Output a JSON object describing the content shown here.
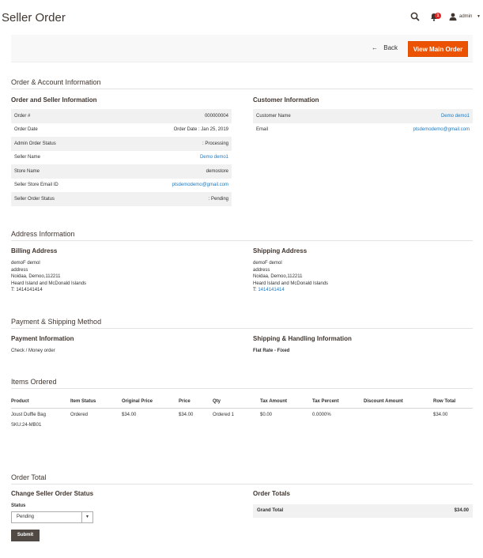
{
  "header": {
    "title": "Seller Order",
    "notification_count": "1",
    "admin_label": "admin"
  },
  "actions": {
    "back_label": "Back",
    "view_main_order_label": "View Main Order"
  },
  "order_account": {
    "section_title": "Order & Account Information",
    "order_seller_title": "Order and Seller Information",
    "rows": [
      {
        "label": "Order #",
        "value": "000000004"
      },
      {
        "label": "Order Date",
        "value": "Order Date : Jan 25, 2019"
      },
      {
        "label": "Admin Order Status",
        "value": ": Processing"
      },
      {
        "label": "Seller Name",
        "value": "Demo demo1"
      },
      {
        "label": "Store Name",
        "value": "demostore"
      },
      {
        "label": "Seller Store Email ID",
        "value": "ptsdemodemo@gmail.com"
      },
      {
        "label": "Seller Order Status",
        "value": ": Pending"
      }
    ],
    "customer_title": "Customer Information",
    "customer_rows": [
      {
        "label": "Customer Name",
        "value": "Demo demo1"
      },
      {
        "label": "Email",
        "value": "ptsdemodemo@gmail.com"
      }
    ]
  },
  "address": {
    "section_title": "Address Information",
    "billing_title": "Billing Address",
    "billing_lines": [
      "demoF demol",
      "address",
      "Noidaa, Demoo,112211",
      "Heard Island and McDonald Islands",
      "T: 1414141414"
    ],
    "shipping_title": "Shipping Address",
    "shipping_lines": [
      "demoF demol",
      "address",
      "Noidaa, Demoo,112211",
      "Heard Island and McDonald Islands"
    ],
    "shipping_phone_prefix": "T: ",
    "shipping_phone": "1414141414"
  },
  "payment": {
    "section_title": "Payment & Shipping Method",
    "payment_title": "Payment Information",
    "payment_method": "Check / Money order",
    "shipping_title": "Shipping & Handling Information",
    "shipping_method": "Flat Rate - Fixed"
  },
  "items": {
    "section_title": "Items Ordered",
    "columns": [
      "Product",
      "Item Status",
      "Original Price",
      "Price",
      "Qty",
      "Tax Amount",
      "Tax Percent",
      "Discount Amount",
      "Row Total"
    ],
    "rows": [
      {
        "product": "Joust Duffle Bag",
        "sku": "SKU:24-MB01",
        "item_status": "Ordered",
        "original_price": "$34.00",
        "price": "$34.00",
        "qty": "Ordered 1",
        "tax_amount": "$0.00",
        "tax_percent": "0.0000%",
        "discount_amount": "",
        "row_total": "$34.00"
      }
    ]
  },
  "order_total": {
    "section_title": "Order Total",
    "change_status_title": "Change Seller Order Status",
    "status_label": "Status",
    "status_value": "Pending",
    "submit_label": "Submit",
    "totals_title": "Order Totals",
    "grand_total_label": "Grand Total",
    "grand_total_value": "$34.00"
  },
  "colors": {
    "accent": "#eb5202",
    "link": "#1979c3",
    "dark_button": "#514943",
    "badge": "#e22626"
  }
}
